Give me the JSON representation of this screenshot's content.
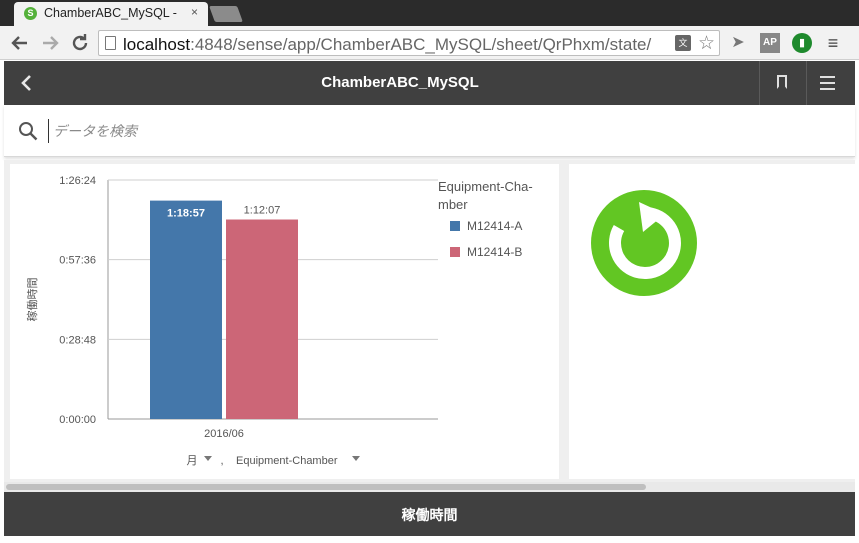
{
  "browser": {
    "tab_title": "ChamberABC_MySQL -",
    "tab_close": "×",
    "url_host": "localhost",
    "url_rest": ":4848/sense/app/ChamberABC_MySQL/sheet/QrPhxm/state/",
    "back_icon": "arrow-left-icon",
    "forward_icon": "arrow-right-icon",
    "reload_icon": "reload-icon",
    "ext_ap": "AP"
  },
  "app": {
    "title": "ChamberABC_MySQL",
    "back_icon": "chevron-left-icon",
    "bookmark_icon": "bookmark-icon",
    "menu_icon": "hamburger-menu-icon"
  },
  "search": {
    "placeholder": "データを検索",
    "icon": "search-icon"
  },
  "chart_data": {
    "type": "bar",
    "categories": [
      "2016/06"
    ],
    "series": [
      {
        "name": "M12414-A",
        "values": [
          4737
        ],
        "label": "1:18:57",
        "color": "#4477aa"
      },
      {
        "name": "M12414-B",
        "values": [
          4327
        ],
        "label": "1:12:07",
        "color": "#cc6677"
      }
    ],
    "ylabel": "稼働時間",
    "yticks": [
      "0:00:00",
      "0:28:48",
      "0:57:36",
      "1:26:24"
    ],
    "ytick_values": [
      0,
      1728,
      3456,
      5184
    ],
    "ylim": [
      0,
      5184
    ],
    "legend_title": "Equipment-Chamber",
    "legend_placement": "right",
    "grid": true,
    "xdim1": "月",
    "xdim2": "Equipment-Chamber",
    "xdim_separator": ","
  },
  "kpi": {
    "icon": "refresh-circle-icon",
    "color": "#62c623"
  },
  "footer": {
    "label": "稼働時間"
  }
}
